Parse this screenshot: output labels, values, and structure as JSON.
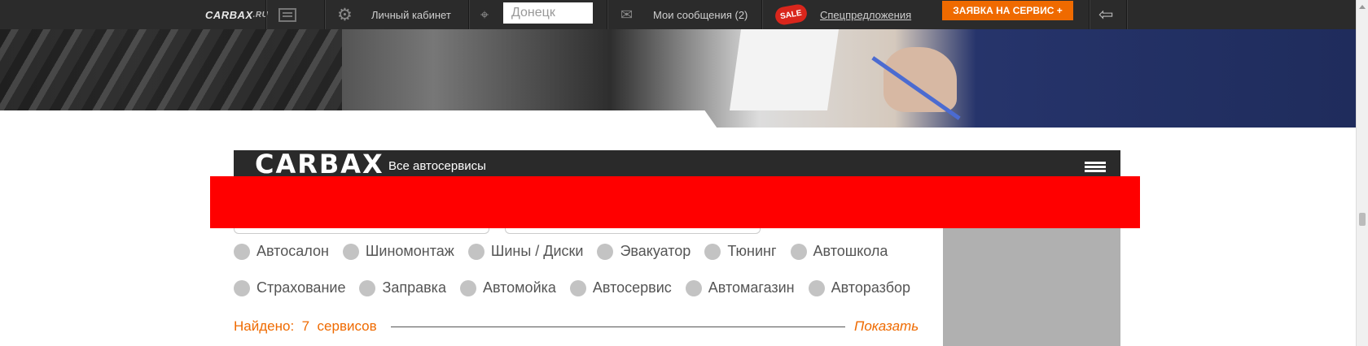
{
  "topbar": {
    "logo": "CARBAX",
    "logo_suffix": ".RU",
    "cabinet_label": "Личный кабинет",
    "city_value": "Донецк",
    "messages_label": "Мои сообщения (2)",
    "sale_badge": "SALE",
    "offers_label": "Спецпредложения",
    "service_button": "ЗАЯВКА НА СЕРВИС +",
    "icons": [
      "catalog-icon",
      "gear-icon",
      "location-pin-icon",
      "mail-icon",
      "exit-icon"
    ]
  },
  "panel": {
    "logo": "CARBAX",
    "subtitle": "Все автосервисы"
  },
  "categories_row1": [
    "Автосалон",
    "Шиномонтаж",
    "Шины / Диски",
    "Эвакуатор",
    "Тюнинг",
    "Автошкола"
  ],
  "categories_row2": [
    "Страхование",
    "Заправка",
    "Автомойка",
    "Автосервис",
    "Автомагазин",
    "Авторазбор"
  ],
  "results": {
    "found_label": "Найдено:",
    "count": "7",
    "unit": "сервисов",
    "show_label": "Показать"
  },
  "colors": {
    "accent": "#ef6a00",
    "topbar_bg": "#2b2b2b",
    "redacted": "#ff0000"
  }
}
